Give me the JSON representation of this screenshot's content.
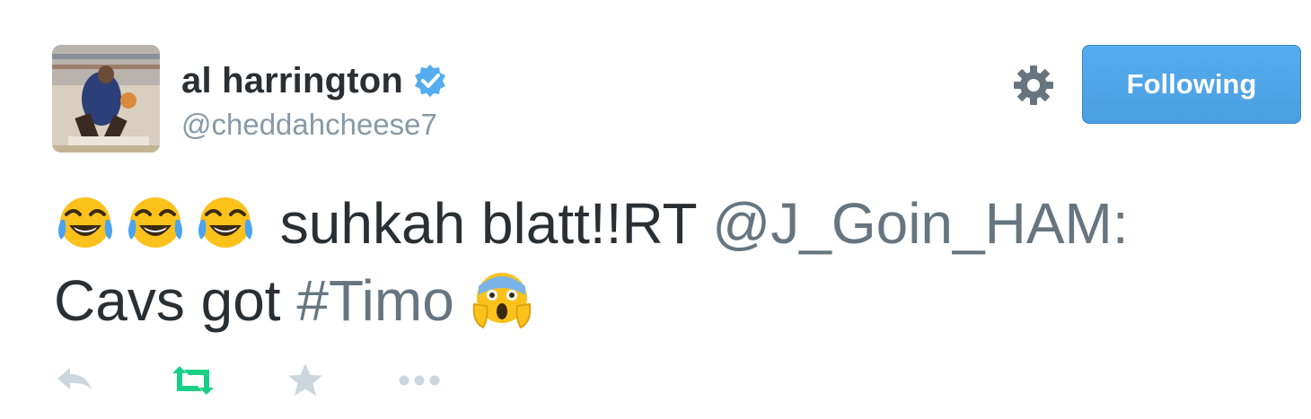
{
  "user": {
    "display_name": "al harrington",
    "handle": "@cheddahcheese7",
    "verified": true,
    "avatar_icon": "profile-photo"
  },
  "header": {
    "settings_icon": "gear-icon",
    "follow_button_label": "Following",
    "follow_button_color": "#55acee"
  },
  "tweet": {
    "leading_emojis": [
      "face-with-tears-of-joy",
      "face-with-tears-of-joy",
      "face-with-tears-of-joy"
    ],
    "text_part1": "suhkah blatt!!RT",
    "mention": "@J_Goin_HAM:",
    "text_part2": "Cavs got",
    "hashtag": "#Timo",
    "trailing_emoji": "face-screaming-in-fear",
    "link_color": "#66757f"
  },
  "actions": {
    "reply_icon": "reply-icon",
    "retweet_icon": "retweet-icon",
    "favorite_icon": "star-icon",
    "more_icon": "more-icon",
    "retweet_active_color": "#19cf86"
  }
}
